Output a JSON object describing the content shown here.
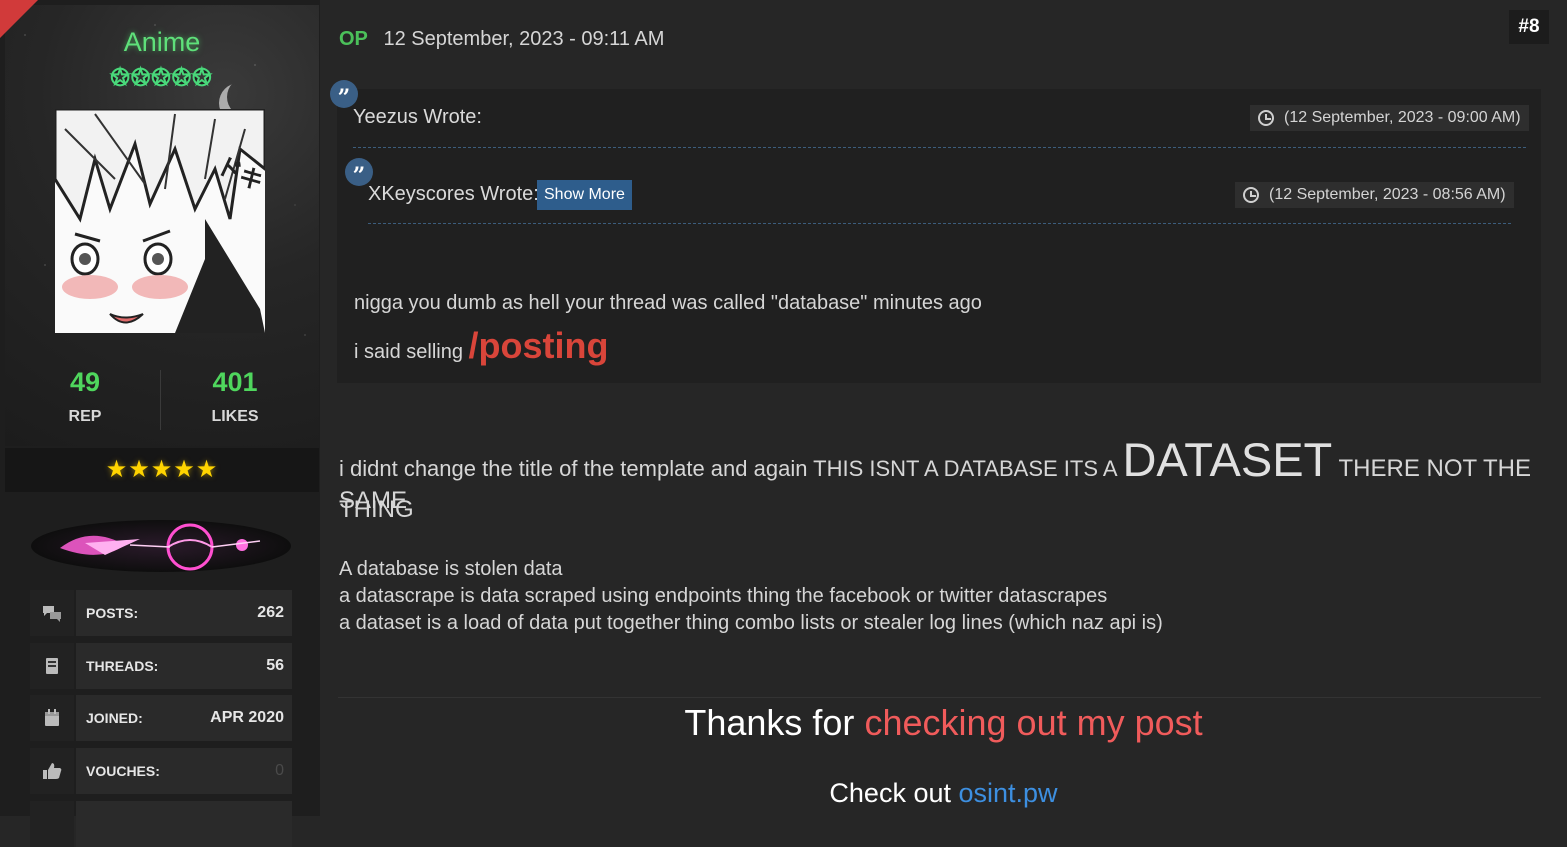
{
  "user": {
    "name": "Anime",
    "rank_stars": "✪✪✪✪✪",
    "rep": "49",
    "rep_label": "REP",
    "likes": "401",
    "likes_label": "LIKES",
    "awards": "★★★★★",
    "info": [
      {
        "icon": "comments-icon",
        "label": "POSTS:",
        "value": "262"
      },
      {
        "icon": "book-icon",
        "label": "THREADS:",
        "value": "56"
      },
      {
        "icon": "calendar-icon",
        "label": "JOINED:",
        "value": "APR 2020"
      },
      {
        "icon": "thumbs-up-icon",
        "label": "VOUCHES:",
        "value": "0"
      }
    ]
  },
  "post": {
    "op_badge": "OP",
    "date": "12 September, 2023 - 09:11 AM",
    "number": "#8",
    "quote": {
      "author": "Yeezus Wrote:",
      "time": "(12 September, 2023 - 09:00 AM)",
      "nested": {
        "author": "XKeyscores Wrote:",
        "show_more": "Show More",
        "time": "(12 September, 2023 - 08:56 AM)"
      },
      "line1": "nigga you dumb as hell your thread was called \"database\" minutes ago",
      "line2_prefix": "i said selling ",
      "line2_emph": "/posting"
    },
    "body": {
      "line1_a": "i didnt change the title of the template and again THIS ISNT A DATABASE ITS A ",
      "line1_big": "DATASET",
      "line1_b": " THERE NOT THE SAME",
      "line2": "THING",
      "def1": "A database is stolen data",
      "def2": "a datascrape is data scraped using endpoints thing the facebook or twitter datascrapes",
      "def3": "a dataset is a load of data put together thing combo lists or stealer log lines (which naz api is)"
    },
    "signature": {
      "w1": "Thanks",
      "w2": "for",
      "w3": "checking",
      "w4": "out",
      "w5": "my",
      "w6": "post",
      "check_prefix": "Check out ",
      "link": "osint.pw"
    }
  },
  "colors": {
    "username": "#5fe07a",
    "stat_green": "#4fd65d",
    "accent_red": "#d9453a",
    "link_blue": "#3d8fe0",
    "quote_icon": "#3a5f86"
  }
}
